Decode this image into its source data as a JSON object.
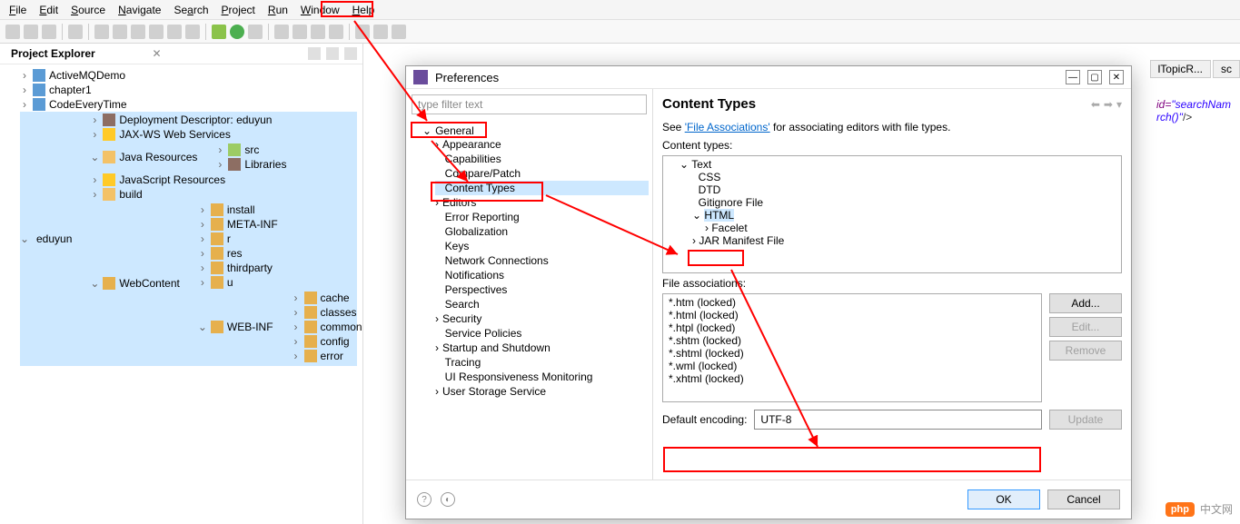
{
  "menu": [
    "File",
    "Edit",
    "Source",
    "Navigate",
    "Search",
    "Project",
    "Run",
    "Window",
    "Help"
  ],
  "projectExplorer": {
    "title": "Project Explorer",
    "tabMarker": "✕",
    "tree": {
      "items": [
        {
          "tw": "›",
          "icon": "proj",
          "label": "ActiveMQDemo"
        },
        {
          "tw": "›",
          "icon": "proj",
          "label": "chapter1"
        },
        {
          "tw": "›",
          "icon": "proj",
          "label": "CodeEveryTime"
        }
      ],
      "openProject": {
        "tw": "⌄",
        "icon": "proj",
        "label": "eduyun",
        "children": [
          {
            "tw": "›",
            "icon": "lib",
            "label": "Deployment Descriptor: eduyun"
          },
          {
            "tw": "›",
            "icon": "js",
            "label": "JAX-WS Web Services"
          }
        ],
        "javaRes": {
          "tw": "⌄",
          "icon": "folder",
          "label": "Java Resources",
          "children": [
            {
              "tw": "›",
              "icon": "pkg",
              "label": "src"
            },
            {
              "tw": "›",
              "icon": "lib",
              "label": "Libraries"
            }
          ]
        },
        "jsRes": {
          "tw": "›",
          "icon": "js",
          "label": "JavaScript Resources"
        },
        "build": {
          "tw": "›",
          "icon": "folder",
          "label": "build"
        },
        "webContent": {
          "tw": "⌄",
          "icon": "foldero",
          "label": "WebContent",
          "children": [
            {
              "tw": "›",
              "icon": "foldero",
              "label": "install"
            },
            {
              "tw": "›",
              "icon": "foldero",
              "label": "META-INF"
            },
            {
              "tw": "›",
              "icon": "foldero",
              "label": "r"
            },
            {
              "tw": "›",
              "icon": "foldero",
              "label": "res"
            },
            {
              "tw": "›",
              "icon": "foldero",
              "label": "thirdparty"
            },
            {
              "tw": "›",
              "icon": "foldero",
              "label": "u"
            }
          ],
          "webinf": {
            "tw": "⌄",
            "icon": "foldero",
            "label": "WEB-INF",
            "children": [
              {
                "tw": "›",
                "icon": "foldero",
                "label": "cache"
              },
              {
                "tw": "›",
                "icon": "foldero",
                "label": "classes"
              },
              {
                "tw": "›",
                "icon": "foldero",
                "label": "common"
              },
              {
                "tw": "›",
                "icon": "foldero",
                "label": "config"
              },
              {
                "tw": "›",
                "icon": "foldero",
                "label": "error"
              }
            ]
          }
        }
      }
    }
  },
  "editor": {
    "tabs": [
      "lTopicR...",
      "sc"
    ],
    "codeLine1a": "id=",
    "codeLine1b": "\"searchNam",
    "codeLine2a": "rch()\"",
    "codeLine2b": "/>"
  },
  "dialog": {
    "title": "Preferences",
    "filterPlaceholder": "type filter text",
    "left": {
      "general": "General",
      "items": [
        "Appearance",
        "Capabilities",
        "Compare/Patch",
        "Content Types",
        "Editors",
        "Error Reporting",
        "Globalization",
        "Keys",
        "Network Connections",
        "Notifications",
        "Perspectives",
        "Search",
        "Security",
        "Service Policies",
        "Startup and Shutdown",
        "Tracing",
        "UI Responsiveness Monitoring",
        "User Storage Service"
      ]
    },
    "right": {
      "heading": "Content Types",
      "descPrefix": "See ",
      "descLink": "'File Associations'",
      "descSuffix": " for associating editors with file types.",
      "ctLabel": "Content types:",
      "ctTree": {
        "root": "Text",
        "children": [
          "CSS",
          "DTD",
          "Gitignore File"
        ],
        "selected": "HTML",
        "selChild": "Facelet",
        "after": [
          "JAR Manifest File"
        ]
      },
      "faLabel": "File associations:",
      "faItems": [
        "*.htm (locked)",
        "*.html (locked)",
        "*.htpl (locked)",
        "*.shtm (locked)",
        "*.shtml (locked)",
        "*.wml (locked)",
        "*.xhtml (locked)"
      ],
      "btnAdd": "Add...",
      "btnEdit": "Edit...",
      "btnRemove": "Remove",
      "encLabel": "Default encoding:",
      "encValue": "UTF-8",
      "btnUpdate": "Update"
    },
    "footer": {
      "ok": "OK",
      "cancel": "Cancel"
    }
  },
  "watermark": {
    "logo": "php",
    "text": "中文网"
  }
}
